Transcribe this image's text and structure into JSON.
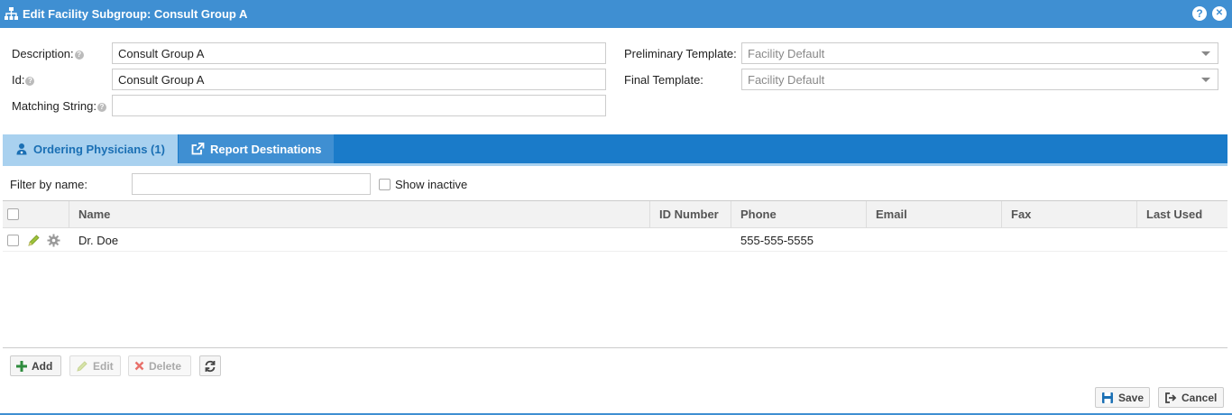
{
  "window": {
    "title": "Edit Facility Subgroup: Consult Group A",
    "help_glyph": "?",
    "close_glyph": "✕",
    "title_icon": "sitemap-icon"
  },
  "form": {
    "description_label": "Description:",
    "description_value": "Consult Group A",
    "id_label": "Id:",
    "id_value": "Consult Group A",
    "matching_label": "Matching String:",
    "matching_value": "",
    "help_glyph": "?",
    "prelim_label": "Preliminary Template:",
    "prelim_value": "Facility Default",
    "final_label": "Final Template:",
    "final_value": "Facility Default"
  },
  "tabs": [
    {
      "label": "Ordering Physicians (1)",
      "icon": "user-doctor-icon",
      "active": true
    },
    {
      "label": "Report Destinations",
      "icon": "external-link-icon",
      "active": false
    }
  ],
  "filter": {
    "label": "Filter by name:",
    "value": "",
    "show_inactive_label": "Show inactive"
  },
  "grid": {
    "columns": [
      "Name",
      "ID Number",
      "Phone",
      "Email",
      "Fax",
      "Last Used"
    ],
    "rows": [
      {
        "name": "Dr. Doe",
        "id_number": "",
        "phone": "555-555-5555",
        "email": "",
        "fax": "",
        "last_used": ""
      }
    ]
  },
  "toolbar": {
    "add_label": "Add",
    "edit_label": "Edit",
    "delete_label": "Delete"
  },
  "footer": {
    "save_label": "Save",
    "cancel_label": "Cancel"
  },
  "colors": {
    "title_bar": "#3f8fd2",
    "tab_bar": "#1a7bc9",
    "active_tab": "#a9d1ef"
  }
}
